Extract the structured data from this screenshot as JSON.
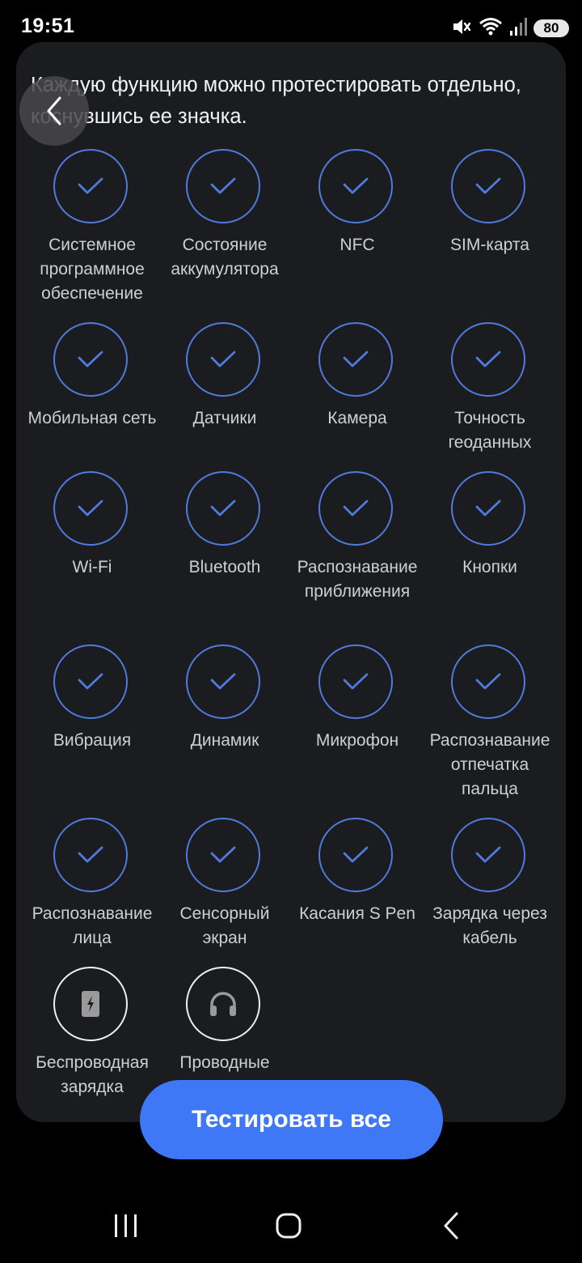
{
  "status_bar": {
    "time": "19:51",
    "battery": "80",
    "icons": [
      "mute-icon",
      "wifi-icon",
      "signal-icon",
      "battery-icon"
    ]
  },
  "intro_text": "Каждую функцию можно протестировать отдельно, коснувшись ее значка.",
  "colors": {
    "accent": "#3e78f6",
    "done_ring": "#4f7bdc",
    "card_bg": "#1b1c20"
  },
  "tests": [
    {
      "label": "Системное программное обеспечение",
      "status": "done"
    },
    {
      "label": "Состояние аккумулятора",
      "status": "done"
    },
    {
      "label": "NFC",
      "status": "done"
    },
    {
      "label": "SIM-карта",
      "status": "done"
    },
    {
      "label": "Мобильная сеть",
      "status": "done"
    },
    {
      "label": "Датчики",
      "status": "done"
    },
    {
      "label": "Камера",
      "status": "done"
    },
    {
      "label": "Точность геоданных",
      "status": "done"
    },
    {
      "label": "Wi-Fi",
      "status": "done"
    },
    {
      "label": "Bluetooth",
      "status": "done"
    },
    {
      "label": "Распознавание приближения",
      "status": "done"
    },
    {
      "label": "Кнопки",
      "status": "done"
    },
    {
      "label": "Вибрация",
      "status": "done"
    },
    {
      "label": "Динамик",
      "status": "done"
    },
    {
      "label": "Микрофон",
      "status": "done"
    },
    {
      "label": "Распознавание отпечатка пальца",
      "status": "done"
    },
    {
      "label": "Распознавание лица",
      "status": "done"
    },
    {
      "label": "Сенсорный экран",
      "status": "done"
    },
    {
      "label": "Касания S Pen",
      "status": "done"
    },
    {
      "label": "Зарядка через кабель",
      "status": "done"
    },
    {
      "label": "Беспроводная зарядка",
      "status": "pending",
      "icon": "wireless-charging-icon"
    },
    {
      "label": "Проводные",
      "status": "pending",
      "icon": "headphones-icon"
    }
  ],
  "test_all_label": "Тестировать все",
  "nav": [
    "recents-icon",
    "home-icon",
    "back-icon"
  ]
}
